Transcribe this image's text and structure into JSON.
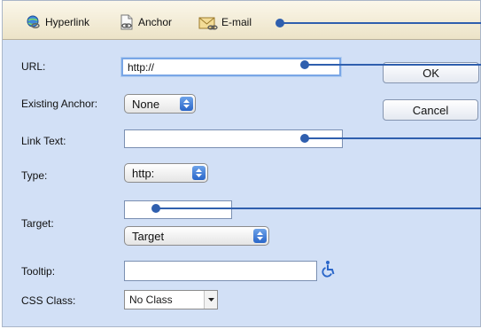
{
  "tabs": [
    {
      "label": "Hyperlink",
      "icon": "globe-link-icon"
    },
    {
      "label": "Anchor",
      "icon": "anchor-icon"
    },
    {
      "label": "E-mail",
      "icon": "envelope-icon"
    }
  ],
  "form": {
    "url_label": "URL:",
    "url_value": "http://",
    "existing_anchor_label": "Existing Anchor:",
    "existing_anchor_value": "None",
    "link_text_label": "Link Text:",
    "link_text_value": "",
    "type_label": "Type:",
    "type_value": "http:",
    "target_label": "Target:",
    "target_text_value": "",
    "target_select_value": "Target",
    "tooltip_label": "Tooltip:",
    "tooltip_value": "",
    "tooltip_icon": "accessibility-icon",
    "css_class_label": "CSS Class:",
    "css_class_value": "No Class"
  },
  "buttons": {
    "ok": "OK",
    "cancel": "Cancel"
  },
  "colors": {
    "dialog_bg": "#d2e0f6",
    "tabbar_bg": "#f5efda",
    "accent": "#2a66c9",
    "callout": "#2f5fae"
  }
}
